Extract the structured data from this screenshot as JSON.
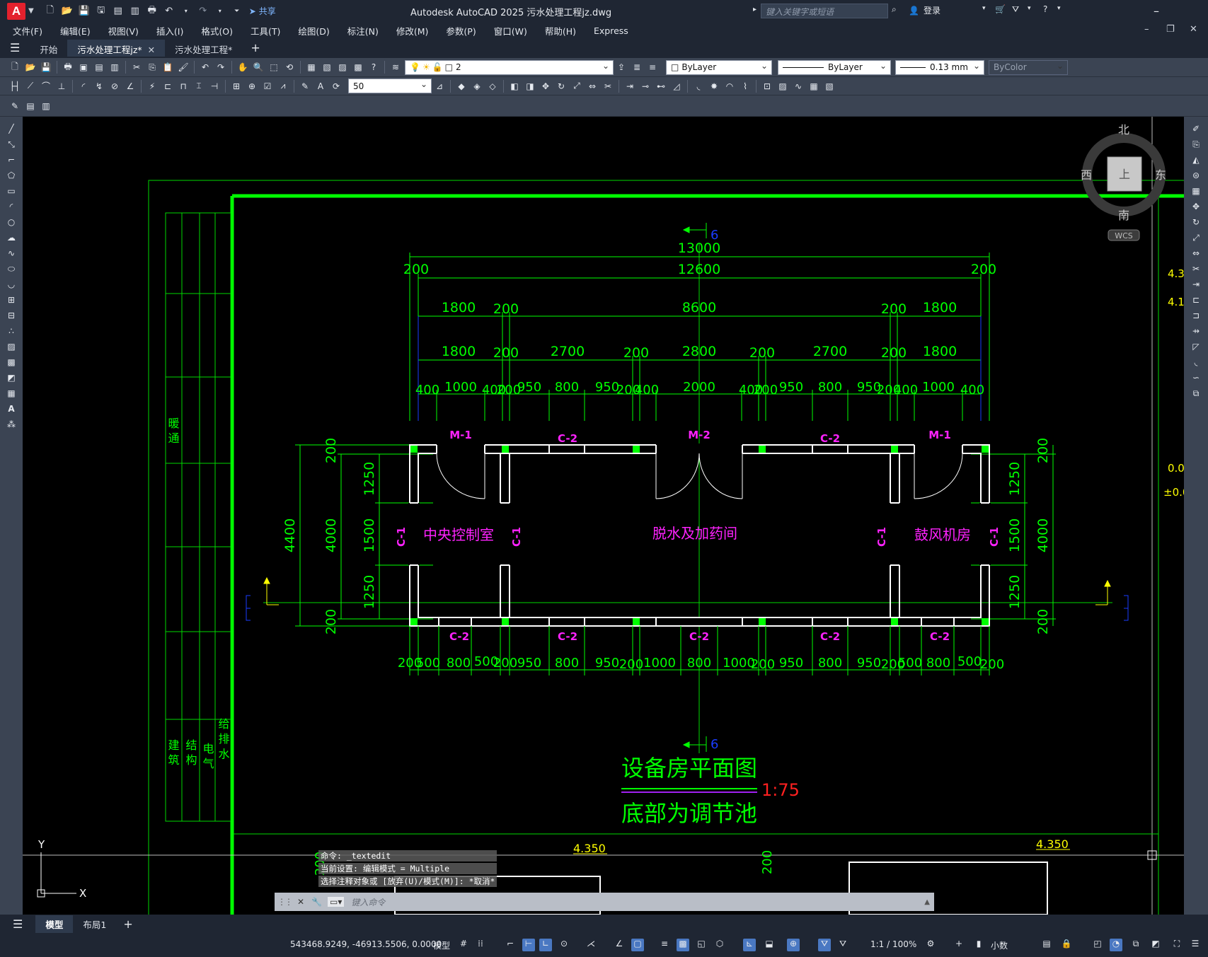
{
  "app": {
    "title": "Autodesk AutoCAD 2025    污水处理工程jz.dwg",
    "logo": "A",
    "share_label": "共享",
    "search_placeholder": "键入关键字或短语",
    "login_label": "登录",
    "menu_extra": "Express"
  },
  "menu": [
    "文件(F)",
    "编辑(E)",
    "视图(V)",
    "插入(I)",
    "格式(O)",
    "工具(T)",
    "绘图(D)",
    "标注(N)",
    "修改(M)",
    "参数(P)",
    "窗口(W)",
    "帮助(H)",
    "Express"
  ],
  "tabs": [
    {
      "label": "开始",
      "active": false
    },
    {
      "label": "污水处理工程jz*",
      "active": true
    },
    {
      "label": "污水处理工程*",
      "active": false
    }
  ],
  "toolbar": {
    "layer_value": "2",
    "color_value": "ByLayer",
    "linetype_value": "ByLayer",
    "lineweight_value": "0.13 mm",
    "plotstyle_value": "ByColor",
    "dimscale_value": "50"
  },
  "viewcube": {
    "north": "北",
    "south": "南",
    "east": "东",
    "west": "西",
    "face": "上",
    "wcs": "WCS"
  },
  "drawing": {
    "title": "设备房平面图",
    "scale": "1:75",
    "subtitle": "底部为调节池",
    "section_mark": "6",
    "room_labels": [
      "中央控制室",
      "脱水及加药间",
      "鼓风机房"
    ],
    "door_labels": [
      "M-1",
      "M-2",
      "M-1"
    ],
    "window_top_labels": [
      "C-2",
      "C-2"
    ],
    "window_bottom_labels": [
      "C-2",
      "C-2",
      "C-2",
      "C-2",
      "C-2"
    ],
    "side_window_labels": [
      "C-1",
      "C-1",
      "C-1",
      "C-1"
    ],
    "dim_row1": [
      "13000"
    ],
    "dim_row2": [
      "200",
      "12600",
      "200"
    ],
    "dim_row3": [
      "1800",
      "200",
      "8600",
      "200",
      "1800"
    ],
    "dim_row4": [
      "1800",
      "200",
      "2700",
      "200",
      "2800",
      "200",
      "2700",
      "200",
      "1800"
    ],
    "dim_row5": [
      "400",
      "1000",
      "400",
      "200",
      "950",
      "800",
      "950",
      "200",
      "400",
      "2000",
      "400",
      "200",
      "950",
      "800",
      "950",
      "200",
      "400",
      "1000",
      "400"
    ],
    "dim_bottom": [
      "200",
      "500",
      "800",
      "500",
      "200",
      "950",
      "800",
      "950",
      "200",
      "1000",
      "800",
      "1000",
      "200",
      "950",
      "800",
      "950",
      "200",
      "500",
      "800",
      "500",
      "200"
    ],
    "dim_left_outer": "4400",
    "dim_left_mid": "4000",
    "dim_left_inner": [
      "200",
      "1250",
      "1500",
      "1250",
      "200"
    ],
    "dim_right_outer": "4000",
    "dim_right_inner": [
      "200",
      "1250",
      "1500",
      "1250",
      "200"
    ],
    "elev_top_1": "4.350",
    "elev_top_2": "4.350",
    "right_edge_texts": [
      "4.3",
      "4.1",
      "0.0",
      "±0.0"
    ],
    "title_block_text": [
      "暖 通",
      "建 筑",
      "结 构",
      "电 气",
      "给 排 水"
    ],
    "lower_dim": "200"
  },
  "command": {
    "history": [
      "命令: _textedit",
      "当前设置: 编辑模式 = Multiple",
      "选择注释对象或 [放弃(U)/模式(M)]: *取消*"
    ],
    "placeholder": "键入命令"
  },
  "layout_tabs": [
    "模型",
    "布局1"
  ],
  "status": {
    "coordinates": "543468.9249, -46913.5506, 0.0000",
    "mode": "模型",
    "scale": "1:1 / 100%",
    "units": "小数"
  },
  "ucs": {
    "x": "X",
    "y": "Y"
  }
}
